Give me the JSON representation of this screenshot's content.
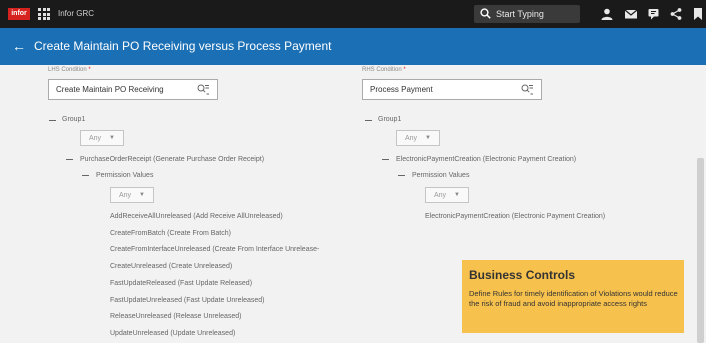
{
  "topbar": {
    "logo": "infor",
    "app_name": "Infor GRC",
    "search_placeholder": "Start Typing"
  },
  "header": {
    "title": "Create Maintain PO Receiving versus Process Payment"
  },
  "lhs": {
    "label": "LHS Condition",
    "value": "Create Maintain PO Receiving",
    "group": "Group1",
    "any": "Any",
    "object": "PurchaseOrderReceipt (Generate Purchase Order Receipt)",
    "permission_label": "Permission Values",
    "permissions": [
      "AddReceiveAllUnreleased (Add Receive AllUnreleased)",
      "CreateFromBatch (Create From Batch)",
      "CreateFromInterfaceUnreleased (Create From Interface Unrelease-",
      "CreateUnreleased (Create Unreleased)",
      "FastUpdateReleased (Fast Update Released)",
      "FastUpdateUnreleased (Fast Update Unreleased)",
      "ReleaseUnreleased (Release Unreleased)",
      "UpdateUnreleased (Update Unreleased)"
    ]
  },
  "rhs": {
    "label": "RHS Condition",
    "value": "Process Payment",
    "group": "Group1",
    "any": "Any",
    "object": "ElectronicPaymentCreation (Electronic Payment Creation)",
    "permission_label": "Permission Values",
    "permissions": [
      "ElectronicPaymentCreation (Electronic Payment Creation)"
    ]
  },
  "callout": {
    "title": "Business Controls",
    "body": "Define Rules for timely identification of Violations would reduce the risk of fraud and avoid inappropriate access rights"
  },
  "colors": {
    "topbar": "#1a1a1a",
    "header": "#1a6fb5",
    "logo": "#d6231f",
    "callout": "#f7c14d"
  }
}
